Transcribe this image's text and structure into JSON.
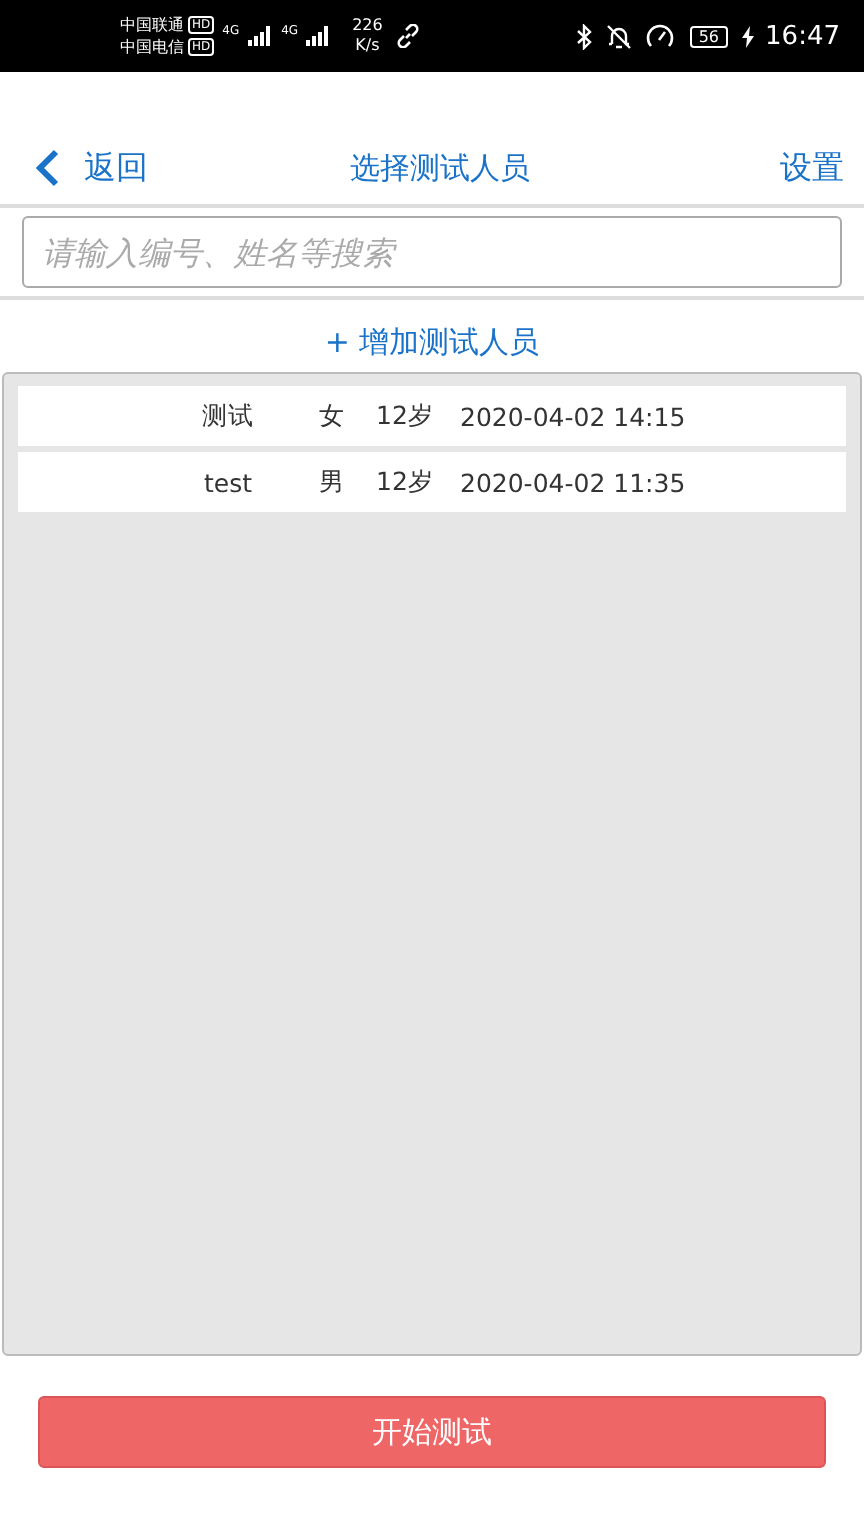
{
  "status_bar": {
    "carriers": [
      {
        "name": "中国联通",
        "badge": "HD"
      },
      {
        "name": "中国电信",
        "badge": "HD"
      }
    ],
    "networks": [
      "4G",
      "4G"
    ],
    "speed": {
      "value": "226",
      "unit": "K/s"
    },
    "battery": "56",
    "time": "16:47"
  },
  "nav": {
    "back": "返回",
    "title": "选择测试人员",
    "action": "设置"
  },
  "search": {
    "placeholder": "请输入编号、姓名等搜索"
  },
  "add_link": "+ 增加测试人员",
  "rows": [
    {
      "name": "测试",
      "sex": "女",
      "age": "12岁",
      "time": "2020-04-02 14:15"
    },
    {
      "name": "test",
      "sex": "男",
      "age": "12岁",
      "time": "2020-04-02 11:35"
    }
  ],
  "start_button": "开始测试"
}
